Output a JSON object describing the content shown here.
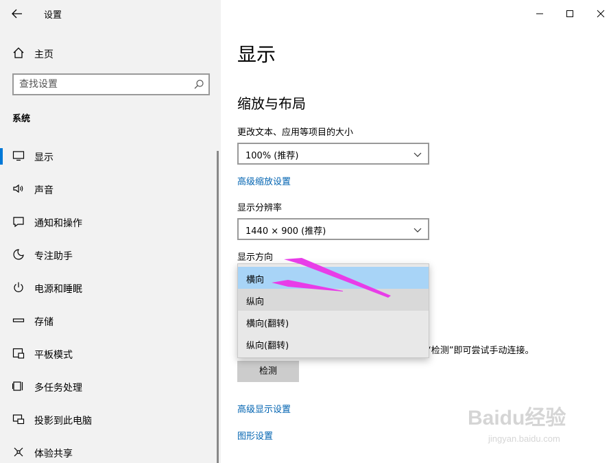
{
  "window": {
    "title": "设置",
    "controls": [
      "minimize",
      "maximize",
      "close"
    ]
  },
  "sidebar": {
    "home_label": "主页",
    "search_placeholder": "查找设置",
    "section_label": "系统",
    "items": [
      {
        "label": "显示",
        "icon": "monitor-icon",
        "active": true
      },
      {
        "label": "声音",
        "icon": "speaker-icon"
      },
      {
        "label": "通知和操作",
        "icon": "notification-icon"
      },
      {
        "label": "专注助手",
        "icon": "moon-icon"
      },
      {
        "label": "电源和睡眠",
        "icon": "power-icon"
      },
      {
        "label": "存储",
        "icon": "storage-icon"
      },
      {
        "label": "平板模式",
        "icon": "tablet-icon"
      },
      {
        "label": "多任务处理",
        "icon": "multitask-icon"
      },
      {
        "label": "投影到此电脑",
        "icon": "project-icon"
      },
      {
        "label": "体验共享",
        "icon": "share-icon"
      }
    ]
  },
  "main": {
    "title": "显示",
    "scale_section_title": "缩放与布局",
    "scale_label": "更改文本、应用等项目的大小",
    "scale_value": "100% (推荐)",
    "advanced_scale_link": "高级缩放设置",
    "resolution_label": "显示分辨率",
    "resolution_value": "1440 × 900 (推荐)",
    "orientation_label": "显示方向",
    "orientation_options": [
      "横向",
      "纵向",
      "横向(翻转)",
      "纵向(翻转)"
    ],
    "orientation_selected": "横向",
    "detect_info": "“检测”即可尝试手动连接。",
    "detect_button": "检测",
    "advanced_display_link": "高级显示设置",
    "graphics_link": "图形设置"
  },
  "colors": {
    "accent": "#0078d7",
    "link": "#0063b1",
    "selected_option": "#a8d4f7",
    "annotation_arrow": "#e83de8"
  },
  "watermark": {
    "brand": "Baidu经验",
    "url": "jingyan.baidu.com"
  }
}
